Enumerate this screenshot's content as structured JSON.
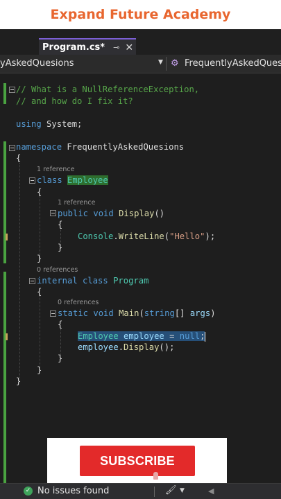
{
  "banner": {
    "title": "Expand Future Academy"
  },
  "tab": {
    "label": "Program.cs*",
    "pin": "⊸",
    "close": "✕"
  },
  "navbar": {
    "left": "yAskedQuesions",
    "right": "FrequentlyAskedQuesio"
  },
  "code": {
    "comment1": "// What is a NullReferenceException,",
    "comment2": "// and how do I fix it?",
    "using_kw": "using",
    "using_ns": " System;",
    "ns_kw": "namespace",
    "ns_name": " FrequentlyAskedQuesions",
    "brace_open": "{",
    "brace_close": "}",
    "lens_employee": "1 reference",
    "class_kw": "class",
    "class_employee": "Employee",
    "lens_display": "1 reference",
    "public_kw": "public",
    "void_kw": "void",
    "display_fn": "Display",
    "parens": "()",
    "console_type": "Console",
    "dot": ".",
    "writeline_fn": "WriteLine",
    "open_paren": "(",
    "hello_str": "\"Hello\"",
    "close_stmt": ");",
    "lens_program": "0 references",
    "internal_kw": "internal",
    "program_type": "Program",
    "lens_main": "0 references",
    "static_kw": "static",
    "main_fn": "Main",
    "string_kw": "string",
    "array_brackets": "[] ",
    "args_id": "args",
    "close_paren": ")",
    "employee_type": "Employee",
    "employee_var": "employee",
    "assign": " = ",
    "null_kw": "null",
    "semicolon": ";",
    "employee_ref": "employee",
    "display_call": "Display",
    "call_end": "();"
  },
  "subscribe": {
    "label": "SUBSCRIBE"
  },
  "status": {
    "issues": "No issues found"
  },
  "colors": {
    "brand": "#e8662f",
    "subscribe": "#e32a2a",
    "keyword": "#569cd6",
    "type": "#4ec9b0",
    "comment": "#57a64a"
  },
  "icons": [
    "pin-icon",
    "close-icon",
    "class-icon",
    "fold-icon",
    "check-circle-icon",
    "brush-icon",
    "cursor-icon"
  ]
}
